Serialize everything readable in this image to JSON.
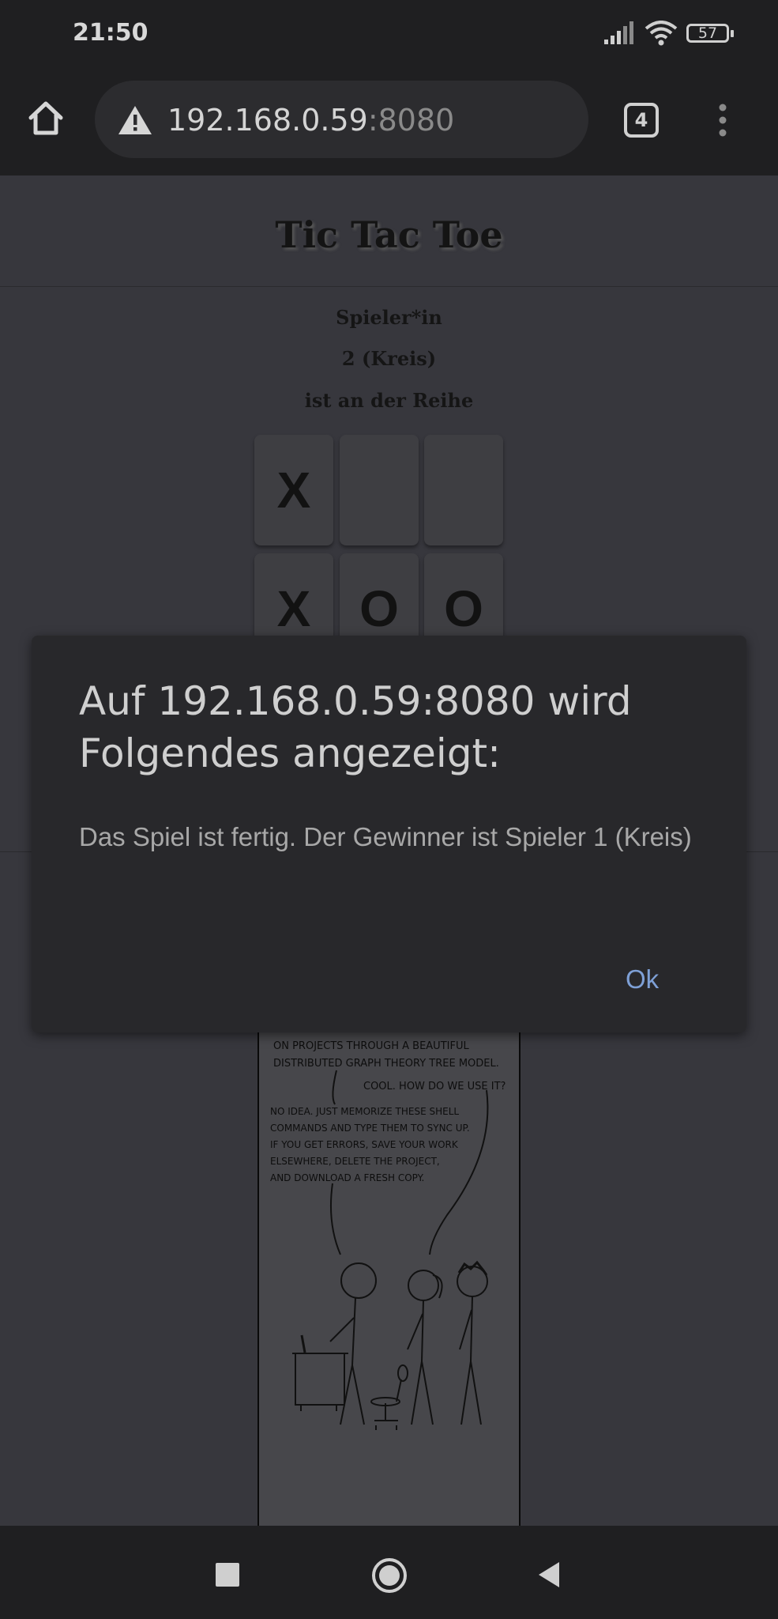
{
  "status_bar": {
    "time": "21:50",
    "battery": "57",
    "icons": [
      "signal-icon",
      "wifi-icon",
      "battery-icon"
    ]
  },
  "browser": {
    "url_host": "192.168.0.59",
    "url_port": ":8080",
    "tab_count": "4",
    "icons": [
      "home-icon",
      "warning-icon",
      "more-vert-icon"
    ]
  },
  "page": {
    "title": "Tic Tac Toe",
    "status_lines": [
      "Spieler*in",
      "2 (Kreis)",
      "ist an der Reihe"
    ],
    "board": [
      [
        "X",
        "",
        ""
      ],
      [
        "X",
        "O",
        "O"
      ]
    ],
    "comic_text": {
      "line1": "ON PROJECTS THROUGH A BEAUTIFUL",
      "line2": "DISTRIBUTED GRAPH THEORY TREE MODEL.",
      "reply": "COOL. HOW DO WE USE IT?",
      "answer": [
        "NO IDEA. JUST MEMORIZE THESE SHELL",
        "COMMANDS AND TYPE THEM TO SYNC UP.",
        "IF YOU GET ERRORS, SAVE YOUR WORK",
        "ELSEWHERE, DELETE THE PROJECT,",
        "AND DOWNLOAD A FRESH COPY."
      ]
    }
  },
  "dialog": {
    "title": "Auf 192.168.0.59:8080 wird Folgendes angezeigt:",
    "message": "Das Spiel ist fertig. Der Gewinner ist Spieler 1 (Kreis)",
    "ok_label": "Ok"
  },
  "colors": {
    "accent": "#7ea0d6",
    "dialog_bg": "#28282b",
    "page_bg": "#37373d",
    "chrome_bg": "#1f1f21"
  }
}
